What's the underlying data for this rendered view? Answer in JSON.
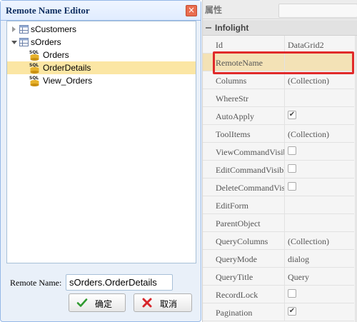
{
  "dialog": {
    "title": "Remote Name Editor",
    "close_glyph": "×",
    "tree": [
      {
        "label": "sCustomers",
        "expanded": false,
        "icon": "table-icon",
        "level": 0
      },
      {
        "label": "sOrders",
        "expanded": true,
        "icon": "table-icon",
        "level": 0
      },
      {
        "label": "Orders",
        "icon": "sql-icon",
        "level": 1
      },
      {
        "label": "OrderDetails",
        "icon": "sql-icon",
        "level": 1,
        "selected": true
      },
      {
        "label": "View_Orders",
        "icon": "sql-icon",
        "level": 1
      }
    ],
    "sql_icon_text": "SQL",
    "remote_name_label": "Remote Name:",
    "remote_name_value": "sOrders.OrderDetails",
    "ok_label": "确定",
    "cancel_label": "取消"
  },
  "properties": {
    "title": "属性",
    "group": "Infolight",
    "rows": [
      {
        "name": "Id",
        "value": "DataGrid2"
      },
      {
        "name": "RemoteName",
        "value": "",
        "highlight": true
      },
      {
        "name": "Columns",
        "value": "(Collection)"
      },
      {
        "name": "WhereStr",
        "value": ""
      },
      {
        "name": "AutoApply",
        "checkbox": true,
        "checked": true
      },
      {
        "name": "ToolItems",
        "value": "(Collection)"
      },
      {
        "name": "ViewCommandVisible",
        "checkbox": true,
        "checked": false
      },
      {
        "name": "EditCommandVisible",
        "checkbox": true,
        "checked": false
      },
      {
        "name": "DeleteCommandVisible",
        "checkbox": true,
        "checked": false
      },
      {
        "name": "EditForm",
        "value": ""
      },
      {
        "name": "ParentObject",
        "value": ""
      },
      {
        "name": "QueryColumns",
        "value": "(Collection)"
      },
      {
        "name": "QueryMode",
        "value": "dialog"
      },
      {
        "name": "QueryTitle",
        "value": "Query"
      },
      {
        "name": "RecordLock",
        "checkbox": true,
        "checked": false
      },
      {
        "name": "Pagination",
        "checkbox": true,
        "checked": true
      }
    ]
  },
  "colors": {
    "highlight_box": "#e02a2a",
    "selected_row": "#fbe6a4",
    "dialog_border": "#95b8e7"
  }
}
